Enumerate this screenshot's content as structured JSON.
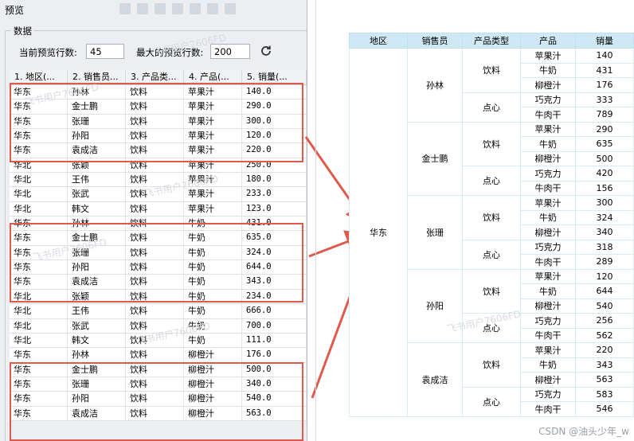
{
  "window": {
    "title": "预览"
  },
  "group": {
    "title": "数据"
  },
  "controls": {
    "current_rows_label": "当前预览行数:",
    "current_rows_value": "45",
    "max_rows_label": "最大的预览行数:",
    "max_rows_value": "200"
  },
  "grid": {
    "headers": [
      "1. 地区(...",
      "2. 销售员...",
      "3. 产品类...",
      "4. 产品(...",
      "5. 销量(..."
    ],
    "rows": [
      [
        "华东",
        "孙林",
        "饮料",
        "苹果汁",
        "140.0"
      ],
      [
        "华东",
        "金士鹏",
        "饮料",
        "苹果汁",
        "290.0"
      ],
      [
        "华东",
        "张珊",
        "饮料",
        "苹果汁",
        "300.0"
      ],
      [
        "华东",
        "孙阳",
        "饮料",
        "苹果汁",
        "120.0"
      ],
      [
        "华东",
        "袁成洁",
        "饮料",
        "苹果汁",
        "220.0"
      ],
      [
        "华北",
        "张颖",
        "饮料",
        "苹果汁",
        "250.0"
      ],
      [
        "华北",
        "王伟",
        "饮料",
        "苹果汁",
        "180.0"
      ],
      [
        "华北",
        "张武",
        "饮料",
        "苹果汁",
        "233.0"
      ],
      [
        "华北",
        "韩文",
        "饮料",
        "苹果汁",
        "123.0"
      ],
      [
        "华东",
        "孙林",
        "饮料",
        "牛奶",
        "431.0"
      ],
      [
        "华东",
        "金士鹏",
        "饮料",
        "牛奶",
        "635.0"
      ],
      [
        "华东",
        "张珊",
        "饮料",
        "牛奶",
        "324.0"
      ],
      [
        "华东",
        "孙阳",
        "饮料",
        "牛奶",
        "644.0"
      ],
      [
        "华东",
        "袁成洁",
        "饮料",
        "牛奶",
        "343.0"
      ],
      [
        "华北",
        "张颖",
        "饮料",
        "牛奶",
        "234.0"
      ],
      [
        "华北",
        "王伟",
        "饮料",
        "牛奶",
        "666.0"
      ],
      [
        "华北",
        "张武",
        "饮料",
        "牛奶",
        "700.0"
      ],
      [
        "华北",
        "韩文",
        "饮料",
        "牛奶",
        "111.0"
      ],
      [
        "华东",
        "孙林",
        "饮料",
        "柳橙汁",
        "176.0"
      ],
      [
        "华东",
        "金士鹏",
        "饮料",
        "柳橙汁",
        "500.0"
      ],
      [
        "华东",
        "张珊",
        "饮料",
        "柳橙汁",
        "340.0"
      ],
      [
        "华东",
        "孙阳",
        "饮料",
        "柳橙汁",
        "540.0"
      ],
      [
        "华东",
        "袁成洁",
        "饮料",
        "柳橙汁",
        "563.0"
      ]
    ]
  },
  "pivot": {
    "headers": [
      "地区",
      "销售员",
      "产品类型",
      "产品",
      "销量"
    ],
    "region": "华东",
    "salespeople": [
      {
        "name": "孙林",
        "groups": [
          {
            "type": "饮料",
            "items": [
              [
                "苹果汁",
                "140"
              ],
              [
                "牛奶",
                "431"
              ],
              [
                "柳橙汁",
                "176"
              ]
            ]
          },
          {
            "type": "点心",
            "items": [
              [
                "巧克力",
                "333"
              ],
              [
                "牛肉干",
                "789"
              ]
            ]
          }
        ]
      },
      {
        "name": "金士鹏",
        "groups": [
          {
            "type": "饮料",
            "items": [
              [
                "苹果汁",
                "290"
              ],
              [
                "牛奶",
                "635"
              ],
              [
                "柳橙汁",
                "500"
              ]
            ]
          },
          {
            "type": "点心",
            "items": [
              [
                "巧克力",
                "420"
              ],
              [
                "牛肉干",
                "156"
              ]
            ]
          }
        ]
      },
      {
        "name": "张珊",
        "groups": [
          {
            "type": "饮料",
            "items": [
              [
                "苹果汁",
                "300"
              ],
              [
                "牛奶",
                "324"
              ],
              [
                "柳橙汁",
                "340"
              ]
            ]
          },
          {
            "type": "点心",
            "items": [
              [
                "巧克力",
                "318"
              ],
              [
                "牛肉干",
                "289"
              ]
            ]
          }
        ]
      },
      {
        "name": "孙阳",
        "groups": [
          {
            "type": "饮料",
            "items": [
              [
                "苹果汁",
                "120"
              ],
              [
                "牛奶",
                "644"
              ],
              [
                "柳橙汁",
                "540"
              ]
            ]
          },
          {
            "type": "点心",
            "items": [
              [
                "巧克力",
                "256"
              ],
              [
                "牛肉干",
                "562"
              ]
            ]
          }
        ]
      },
      {
        "name": "袁成洁",
        "groups": [
          {
            "type": "饮料",
            "items": [
              [
                "苹果汁",
                "220"
              ],
              [
                "牛奶",
                "343"
              ],
              [
                "柳橙汁",
                "563"
              ]
            ]
          },
          {
            "type": "点心",
            "items": [
              [
                "巧克力",
                "583"
              ],
              [
                "牛肉干",
                "546"
              ]
            ]
          }
        ]
      }
    ]
  },
  "watermarks": [
    "飞书用户7606FD",
    "飞书用户7606FD",
    "飞书用户7606FD",
    "飞书用户7606FD",
    "飞书用户7606FD",
    "飞书用户7606FD"
  ],
  "credit": "CSDN @油头少年_w",
  "colors": {
    "highlight": "#e05a4b",
    "pivot_header": "#cfe8f6"
  }
}
